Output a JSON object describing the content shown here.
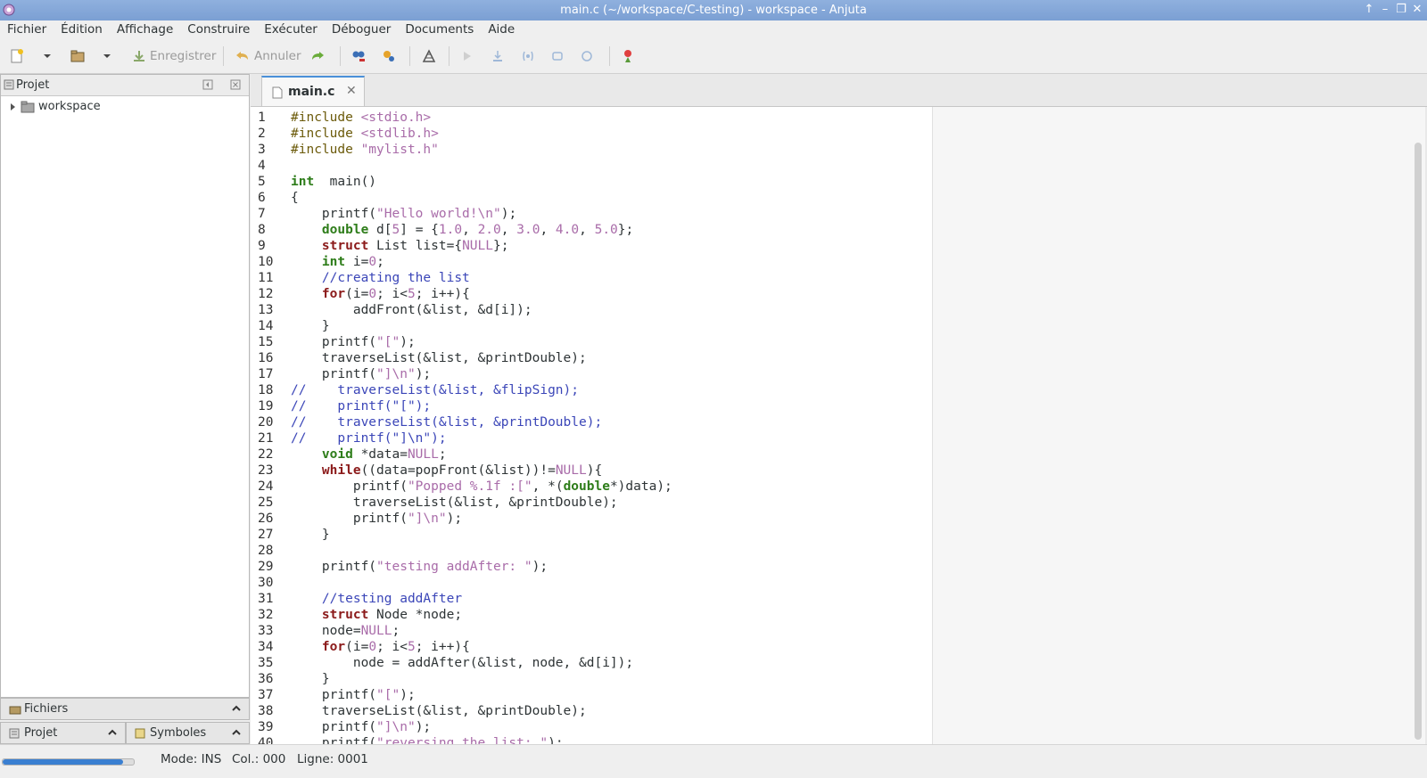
{
  "window": {
    "title": "main.c (~/workspace/C-testing) - workspace - Anjuta"
  },
  "menu": [
    "Fichier",
    "Édition",
    "Affichage",
    "Construire",
    "Exécuter",
    "Déboguer",
    "Documents",
    "Aide"
  ],
  "toolbar": {
    "save_label": "Enregistrer",
    "undo_label": "Annuler"
  },
  "left_panel": {
    "title": "Projet",
    "tree_root": "workspace"
  },
  "bottom_tabs": {
    "files": "Fichiers",
    "project": "Projet",
    "symbols": "Symboles"
  },
  "editor": {
    "tab_label": "main.c",
    "lines": [
      [
        [
          "pp",
          "#include "
        ],
        [
          "st",
          "<stdio.h>"
        ]
      ],
      [
        [
          "pp",
          "#include "
        ],
        [
          "st",
          "<stdlib.h>"
        ]
      ],
      [
        [
          "pp",
          "#include "
        ],
        [
          "st",
          "\"mylist.h\""
        ]
      ],
      [],
      [
        [
          "ty",
          "int"
        ],
        [
          "",
          "  main()"
        ]
      ],
      [
        [
          "",
          "{"
        ]
      ],
      [
        [
          "",
          "    printf("
        ],
        [
          "st",
          "\"Hello world!\\n\""
        ],
        [
          "",
          ");"
        ]
      ],
      [
        [
          "",
          "    "
        ],
        [
          "ty",
          "double"
        ],
        [
          "",
          " d["
        ],
        [
          "nu",
          "5"
        ],
        [
          "",
          "] = {"
        ],
        [
          "nu",
          "1.0"
        ],
        [
          "",
          ", "
        ],
        [
          "nu",
          "2.0"
        ],
        [
          "",
          ", "
        ],
        [
          "nu",
          "3.0"
        ],
        [
          "",
          ", "
        ],
        [
          "nu",
          "4.0"
        ],
        [
          "",
          ", "
        ],
        [
          "nu",
          "5.0"
        ],
        [
          "",
          "};"
        ]
      ],
      [
        [
          "",
          "    "
        ],
        [
          "kw",
          "struct"
        ],
        [
          "",
          " List list={"
        ],
        [
          "nu",
          "NULL"
        ],
        [
          "",
          "};"
        ]
      ],
      [
        [
          "",
          "    "
        ],
        [
          "ty",
          "int"
        ],
        [
          "",
          " i="
        ],
        [
          "nu",
          "0"
        ],
        [
          "",
          ";"
        ]
      ],
      [
        [
          "",
          "    "
        ],
        [
          "cm",
          "//creating the list"
        ]
      ],
      [
        [
          "",
          "    "
        ],
        [
          "kw",
          "for"
        ],
        [
          "",
          "(i="
        ],
        [
          "nu",
          "0"
        ],
        [
          "",
          "; i<"
        ],
        [
          "nu",
          "5"
        ],
        [
          "",
          "; i++){"
        ]
      ],
      [
        [
          "",
          "        addFront(&list, &d[i]);"
        ]
      ],
      [
        [
          "",
          "    }"
        ]
      ],
      [
        [
          "",
          "    printf("
        ],
        [
          "st",
          "\"[\""
        ],
        [
          "",
          ");"
        ]
      ],
      [
        [
          "",
          "    traverseList(&list, &printDouble);"
        ]
      ],
      [
        [
          "",
          "    printf("
        ],
        [
          "st",
          "\"]\\n\""
        ],
        [
          "",
          ");"
        ]
      ],
      [
        [
          "cm",
          "//    traverseList(&list, &flipSign);"
        ]
      ],
      [
        [
          "cm",
          "//    printf(\"[\");"
        ]
      ],
      [
        [
          "cm",
          "//    traverseList(&list, &printDouble);"
        ]
      ],
      [
        [
          "cm",
          "//    printf(\"]\\n\");"
        ]
      ],
      [
        [
          "",
          "    "
        ],
        [
          "ty",
          "void"
        ],
        [
          "",
          " *data="
        ],
        [
          "nu",
          "NULL"
        ],
        [
          "",
          ";"
        ]
      ],
      [
        [
          "",
          "    "
        ],
        [
          "kw",
          "while"
        ],
        [
          "",
          "((data=popFront(&list))!="
        ],
        [
          "nu",
          "NULL"
        ],
        [
          "",
          "){"
        ]
      ],
      [
        [
          "",
          "        printf("
        ],
        [
          "st",
          "\"Popped %.1f :[\""
        ],
        [
          "",
          ", *("
        ],
        [
          "ty",
          "double"
        ],
        [
          "",
          "*)data);"
        ]
      ],
      [
        [
          "",
          "        traverseList(&list, &printDouble);"
        ]
      ],
      [
        [
          "",
          "        printf("
        ],
        [
          "st",
          "\"]\\n\""
        ],
        [
          "",
          ");"
        ]
      ],
      [
        [
          "",
          "    }"
        ]
      ],
      [],
      [
        [
          "",
          "    printf("
        ],
        [
          "st",
          "\"testing addAfter: \""
        ],
        [
          "",
          ");"
        ]
      ],
      [],
      [
        [
          "",
          "    "
        ],
        [
          "cm",
          "//testing addAfter"
        ]
      ],
      [
        [
          "",
          "    "
        ],
        [
          "kw",
          "struct"
        ],
        [
          "",
          " Node *node;"
        ]
      ],
      [
        [
          "",
          "    node="
        ],
        [
          "nu",
          "NULL"
        ],
        [
          "",
          ";"
        ]
      ],
      [
        [
          "",
          "    "
        ],
        [
          "kw",
          "for"
        ],
        [
          "",
          "(i="
        ],
        [
          "nu",
          "0"
        ],
        [
          "",
          "; i<"
        ],
        [
          "nu",
          "5"
        ],
        [
          "",
          "; i++){"
        ]
      ],
      [
        [
          "",
          "        node = addAfter(&list, node, &d[i]);"
        ]
      ],
      [
        [
          "",
          "    }"
        ]
      ],
      [
        [
          "",
          "    printf("
        ],
        [
          "st",
          "\"[\""
        ],
        [
          "",
          ");"
        ]
      ],
      [
        [
          "",
          "    traverseList(&list, &printDouble);"
        ]
      ],
      [
        [
          "",
          "    printf("
        ],
        [
          "st",
          "\"]\\n\""
        ],
        [
          "",
          ");"
        ]
      ],
      [
        [
          "",
          "    printf("
        ],
        [
          "st",
          "\"reversing the list: \""
        ],
        [
          "",
          ");"
        ]
      ]
    ]
  },
  "statusbar": {
    "mode": "Mode: INS",
    "col": "Col.: 000",
    "line": "Ligne: 0001",
    "progress_fraction": 0.92
  },
  "colors": {
    "titlebar": "#7b9fd3",
    "keyword": "#8b1a1a",
    "type": "#2e7d1a",
    "string": "#a96ca9",
    "comment": "#3b46b8",
    "tab_accent": "#4a90d9"
  }
}
